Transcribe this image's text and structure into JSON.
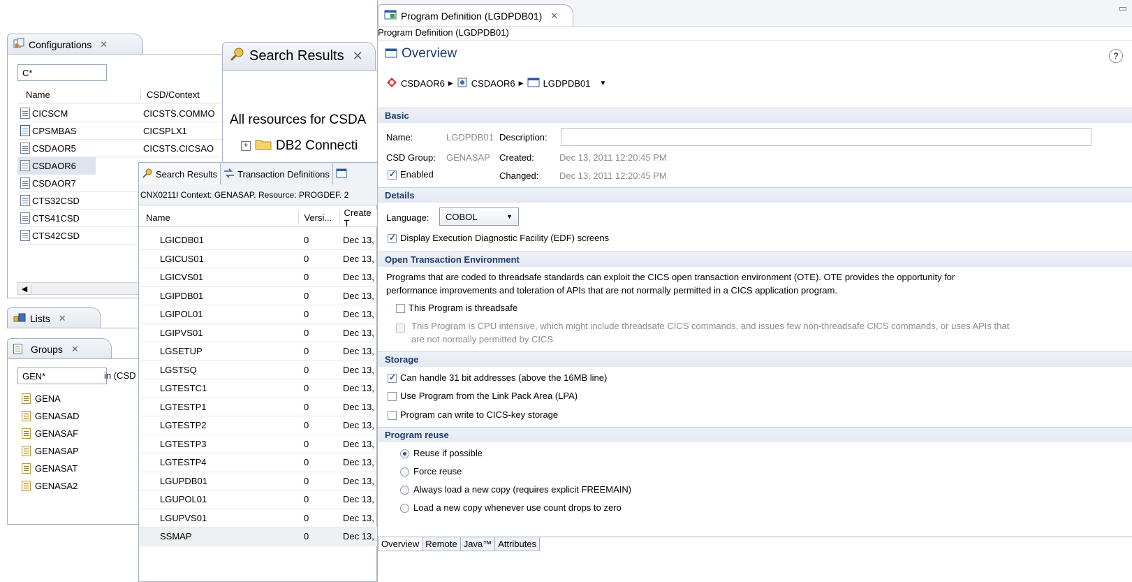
{
  "configurations": {
    "tab_label": "Configurations",
    "filter_value": "C*",
    "columns": [
      "Name",
      "CSD/Context"
    ],
    "rows": [
      {
        "name": "CICSCM",
        "context": "CICSTS.COMMO"
      },
      {
        "name": "CPSMBAS",
        "context": "CICSPLX1"
      },
      {
        "name": "CSDAOR5",
        "context": "CICSTS.CICSAO"
      },
      {
        "name": "CSDAOR6",
        "context": ""
      },
      {
        "name": "CSDAOR7",
        "context": ""
      },
      {
        "name": "CTS32CSD",
        "context": ""
      },
      {
        "name": "CTS41CSD",
        "context": ""
      },
      {
        "name": "CTS42CSD",
        "context": ""
      }
    ]
  },
  "lists": {
    "tab_label": "Lists"
  },
  "groups": {
    "tab_label": "Groups",
    "filter_value": "GEN*",
    "scope_label": "in (CSD",
    "items": [
      "GENA",
      "GENASAD",
      "GENASAF",
      "GENASAP",
      "GENASAT",
      "GENASA2"
    ]
  },
  "search_back": {
    "tab_label": "Search Results",
    "heading": "All resources for CSDA",
    "tree_item": "DB2 Connecti"
  },
  "search_front": {
    "tabs": [
      "Search Results",
      "Transaction Definitions"
    ],
    "status": "CNX0211I Context: GENASAP. Resource: PROGDEF. 2",
    "columns": [
      "Name",
      "Versi...",
      "Create T"
    ],
    "rows": [
      {
        "name": "LGICDB01",
        "version": "0",
        "created": "Dec 13,"
      },
      {
        "name": "LGICUS01",
        "version": "0",
        "created": "Dec 13,"
      },
      {
        "name": "LGICVS01",
        "version": "0",
        "created": "Dec 13,"
      },
      {
        "name": "LGIPDB01",
        "version": "0",
        "created": "Dec 13,"
      },
      {
        "name": "LGIPOL01",
        "version": "0",
        "created": "Dec 13,"
      },
      {
        "name": "LGIPVS01",
        "version": "0",
        "created": "Dec 13,"
      },
      {
        "name": "LGSETUP",
        "version": "0",
        "created": "Dec 13,"
      },
      {
        "name": "LGSTSQ",
        "version": "0",
        "created": "Dec 13,"
      },
      {
        "name": "LGTESTC1",
        "version": "0",
        "created": "Dec 13,"
      },
      {
        "name": "LGTESTP1",
        "version": "0",
        "created": "Dec 13,"
      },
      {
        "name": "LGTESTP2",
        "version": "0",
        "created": "Dec 13,"
      },
      {
        "name": "LGTESTP3",
        "version": "0",
        "created": "Dec 13,"
      },
      {
        "name": "LGTESTP4",
        "version": "0",
        "created": "Dec 13,"
      },
      {
        "name": "LGUPDB01",
        "version": "0",
        "created": "Dec 13,"
      },
      {
        "name": "LGUPOL01",
        "version": "0",
        "created": "Dec 13,"
      },
      {
        "name": "LGUPVS01",
        "version": "0",
        "created": "Dec 13,"
      },
      {
        "name": "SSMAP",
        "version": "0",
        "created": "Dec 13,"
      }
    ]
  },
  "editor": {
    "tab_label": "Program Definition (LGDPDB01)",
    "breadcrumb_title": "Program Definition (LGDPDB01)",
    "overview_title": "Overview",
    "help": "?",
    "path": [
      "CSDAOR6",
      "CSDAOR6",
      "LGDPDB01"
    ],
    "basic": {
      "title": "Basic",
      "name_label": "Name:",
      "name_value": "LGDPDB01",
      "description_label": "Description:",
      "description_value": "",
      "csd_group_label": "CSD Group:",
      "csd_group_value": "GENASAP",
      "created_label": "Created:",
      "created_value": "Dec 13, 2011 12:20:45 PM",
      "enabled_label": "Enabled",
      "changed_label": "Changed:",
      "changed_value": "Dec 13, 2011 12:20:45 PM"
    },
    "details": {
      "title": "Details",
      "language_label": "Language:",
      "language_value": "COBOL",
      "edf_label": "Display Execution Diagnostic Facility (EDF) screens"
    },
    "ote": {
      "title": "Open Transaction Environment",
      "desc_line1": "Programs that are coded to threadsafe standards can exploit the CICS open transaction environment (OTE). OTE provides the opportunity for",
      "desc_line2": "performance improvements and toleration of APIs that are not normally permitted in a CICS application program.",
      "threadsafe_label": "This Program is threadsafe",
      "cpu_line1": "This Program is CPU intensive, which might include threadsafe CICS commands, and issues few non-threadsafe CICS commands, or uses APIs that",
      "cpu_line2": "are not normally permitted by CICS"
    },
    "storage": {
      "title": "Storage",
      "opt1": "Can handle 31 bit addresses (above the 16MB line)",
      "opt2": "Use Program from the Link Pack Area (LPA)",
      "opt3": "Program can write to CICS-key storage"
    },
    "reuse": {
      "title": "Program reuse",
      "options": [
        "Reuse if possible",
        "Force reuse",
        "Always load a new copy (requires explicit FREEMAIN)",
        "Load a new copy whenever use count drops to zero"
      ]
    },
    "bottom_tabs": [
      "Overview",
      "Remote",
      "Java™",
      "Attributes"
    ]
  }
}
